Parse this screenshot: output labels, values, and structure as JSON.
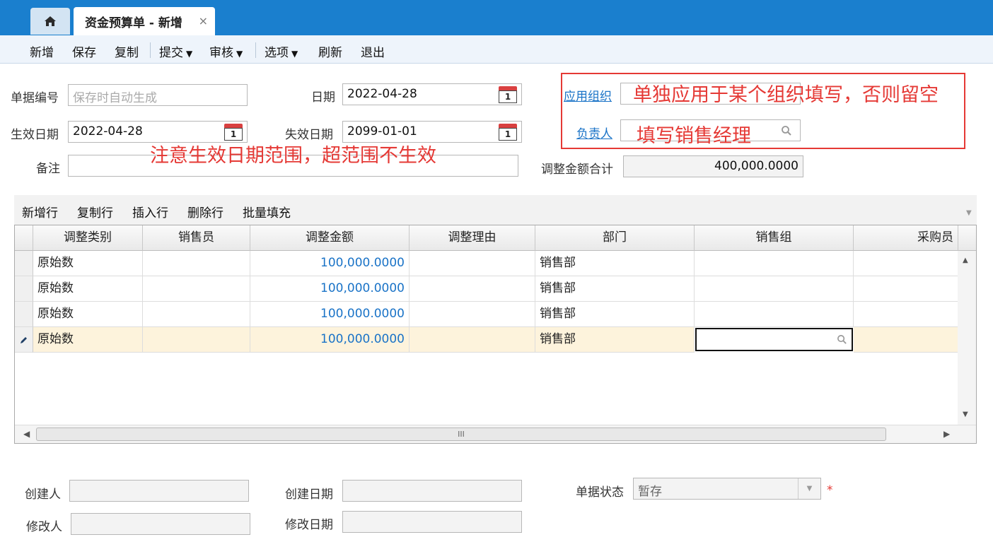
{
  "tabs": {
    "home_icon": "home-icon",
    "active_title": "资金预算单 - 新增",
    "close_glyph": "×"
  },
  "toolbar": {
    "new": "新增",
    "save": "保存",
    "copy": "复制",
    "submit": "提交",
    "audit": "审核",
    "options": "选项",
    "refresh": "刷新",
    "exit": "退出"
  },
  "form": {
    "doc_no_label": "单据编号",
    "doc_no_placeholder": "保存时自动生成",
    "date_label": "日期",
    "date_value": "2022-04-28",
    "effective_label": "生效日期",
    "effective_value": "2022-04-28",
    "expire_label": "失效日期",
    "expire_value": "2099-01-01",
    "remark_label": "备注",
    "remark_value": "",
    "org_label": "应用组织",
    "owner_label": "负责人",
    "total_label": "调整金额合计",
    "total_value": "400,000.0000",
    "calendar_day": "1"
  },
  "annotations": {
    "org_note": "单独应用于某个组织填写，否则留空",
    "owner_note": "填写销售经理",
    "date_note": "注意生效日期范围，超范围不生效",
    "color": "#e53935"
  },
  "grid_toolbar": {
    "add_row": "新增行",
    "copy_row": "复制行",
    "insert_row": "插入行",
    "delete_row": "删除行",
    "batch_fill": "批量填充"
  },
  "grid": {
    "columns": [
      "调整类别",
      "销售员",
      "调整金额",
      "调整理由",
      "部门",
      "销售组",
      "采购员"
    ],
    "rows": [
      {
        "type": "原始数",
        "salesman": "",
        "amount": "100,000.0000",
        "reason": "",
        "dept": "销售部",
        "group": "",
        "buyer": ""
      },
      {
        "type": "原始数",
        "salesman": "",
        "amount": "100,000.0000",
        "reason": "",
        "dept": "销售部",
        "group": "",
        "buyer": ""
      },
      {
        "type": "原始数",
        "salesman": "",
        "amount": "100,000.0000",
        "reason": "",
        "dept": "销售部",
        "group": "",
        "buyer": ""
      },
      {
        "type": "原始数",
        "salesman": "",
        "amount": "100,000.0000",
        "reason": "",
        "dept": "销售部",
        "group": "",
        "buyer": ""
      }
    ],
    "scroll_grip": "III"
  },
  "footer": {
    "creator_label": "创建人",
    "created_date_label": "创建日期",
    "status_label": "单据状态",
    "status_value": "暂存",
    "modifier_label": "修改人",
    "modified_date_label": "修改日期",
    "required_mark": "*"
  }
}
